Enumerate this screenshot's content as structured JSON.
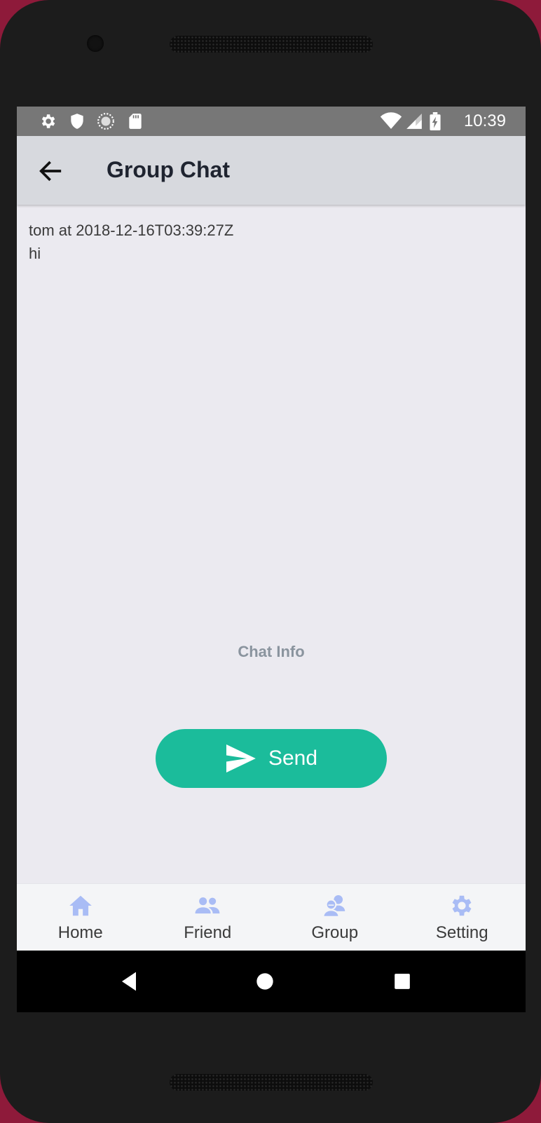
{
  "status_bar": {
    "time": "10:39",
    "left_icons": [
      "gear-icon",
      "shield-icon",
      "sync-icon",
      "sd-card-icon"
    ],
    "right_icons": [
      "wifi-icon",
      "signal-icon",
      "battery-charging-icon"
    ]
  },
  "app_bar": {
    "title": "Group Chat",
    "back_icon": "arrow-back-icon"
  },
  "messages": [
    {
      "header": "tom at 2018-12-16T03:39:27Z",
      "text": "hi"
    }
  ],
  "chat_info_label": "Chat Info",
  "send_button": {
    "label": "Send",
    "icon": "send-icon"
  },
  "tabs": [
    {
      "label": "Home",
      "icon": "home-icon"
    },
    {
      "label": "Friend",
      "icon": "people-icon"
    },
    {
      "label": "Group",
      "icon": "group-chat-icon"
    },
    {
      "label": "Setting",
      "icon": "gear-icon"
    }
  ],
  "colors": {
    "accent": "#1bbc9b",
    "tab_icon": "#a9bcf5",
    "app_bar": "#d7d9de",
    "background": "#ebeaf0"
  }
}
